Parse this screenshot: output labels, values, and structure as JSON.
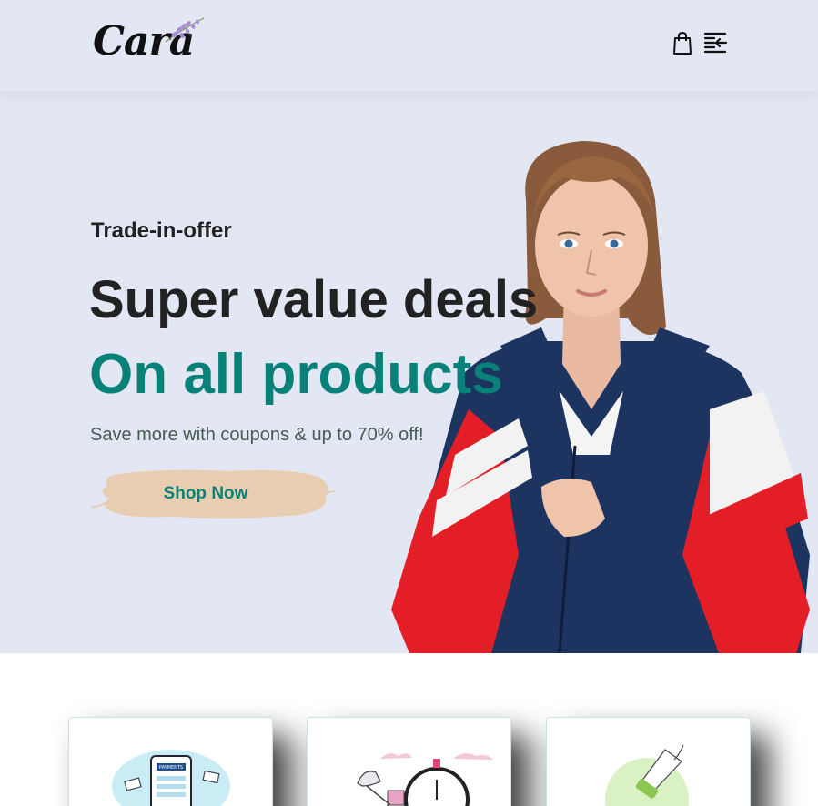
{
  "header": {
    "logo_text": "Cara",
    "icons": [
      "shopping-bag-icon",
      "menu-icon"
    ]
  },
  "hero": {
    "pretitle": "Trade-in-offer",
    "title": "Super value deals",
    "highlight": "On all products",
    "subtitle": "Save more with coupons & up to 70% off!",
    "cta_label": "Shop Now"
  },
  "features": {
    "items": [
      {
        "icon": "online-payment-illustration",
        "mini_label": "PAYMENTS"
      },
      {
        "icon": "fast-delivery-illustration"
      },
      {
        "icon": "save-money-illustration"
      }
    ]
  },
  "colors": {
    "background": "#e3e6f3",
    "accent": "#088178",
    "button_brush": "#e8cdb0",
    "text_dark": "#222222"
  }
}
